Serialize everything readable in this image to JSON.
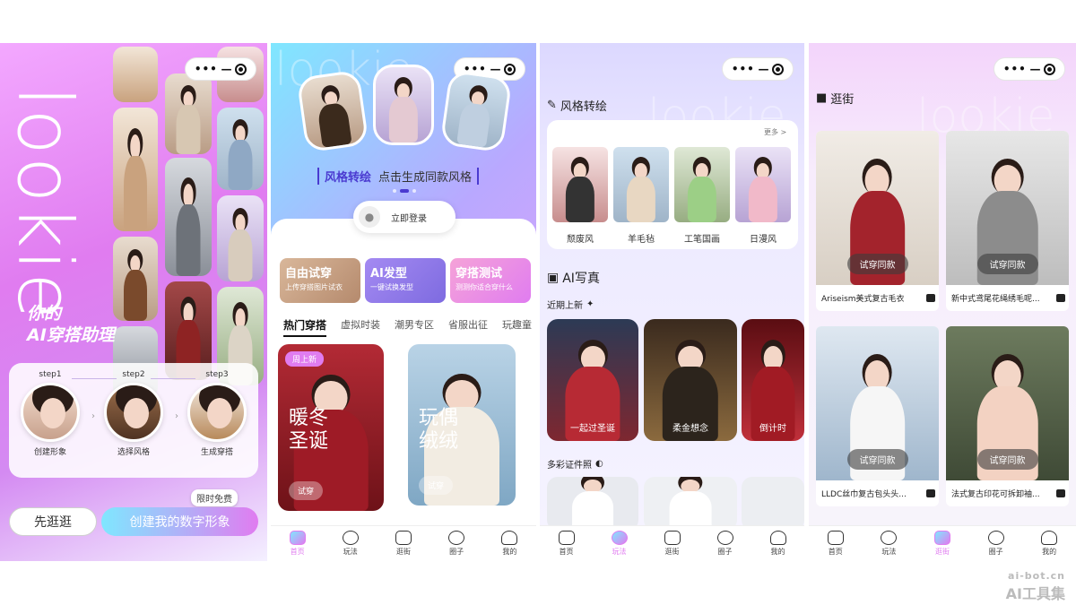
{
  "panel1": {
    "brand": "lookie",
    "tagline_1": "你的",
    "tagline_2": "AI穿搭助理",
    "steps": [
      {
        "step": "step1",
        "label": "创建形象"
      },
      {
        "step": "step2",
        "label": "选择风格"
      },
      {
        "step": "step3",
        "label": "生成穿搭"
      }
    ],
    "stroll_button": "先逛逛",
    "create_button": "创建我的数字形象",
    "free_badge": "限时免费"
  },
  "panel2": {
    "banner_title": "风格转绘",
    "banner_sub": "点击生成同款风格",
    "login_label": "立即登录",
    "features": [
      {
        "title": "自由试穿",
        "sub": "上传穿搭图片试衣"
      },
      {
        "title": "AI发型",
        "sub": "一键试换发型"
      },
      {
        "title": "穿搭测试",
        "sub": "测测你适合穿什么"
      }
    ],
    "tabs": [
      "热门穿搭",
      "虚拟时装",
      "潮男专区",
      "省服出征",
      "玩趣童"
    ],
    "card1": {
      "badge": "周上新",
      "title_1": "暖冬",
      "title_2": "圣诞",
      "button": "试穿"
    },
    "card2": {
      "title_1": "玩偶",
      "title_2": "绒绒",
      "button": "试穿"
    }
  },
  "panel3": {
    "style_title": "风格转绘",
    "more": "更多 >",
    "styles": [
      "颓废风",
      "羊毛毡",
      "工笔国画",
      "日漫风"
    ],
    "ai_photo_title": "AI写真",
    "recent_label": "近期上新",
    "photos": [
      "一起过圣诞",
      "柔金想念",
      "倒计时"
    ],
    "id_photo_label": "多彩证件照"
  },
  "panel4": {
    "title": "逛街",
    "products": [
      {
        "name": "Ariseism美式复古毛衣",
        "button": "试穿同款"
      },
      {
        "name": "新中式鸢尾花绳绣毛呢...",
        "button": "试穿同款"
      },
      {
        "name": "LLDC丝巾复古包头头...",
        "button": "试穿同款"
      },
      {
        "name": "法式复古印花可拆卸袖...",
        "button": "试穿同款"
      }
    ]
  },
  "tabbar": [
    "首页",
    "玩法",
    "逛街",
    "圈子",
    "我的"
  ],
  "watermark": {
    "url": "ai-bot.cn",
    "name": "AI工具集"
  },
  "colors": {
    "accent_pink": "#e07cf0",
    "accent_cyan": "#7fe7ff",
    "accent_purple": "#4a3ad0"
  }
}
